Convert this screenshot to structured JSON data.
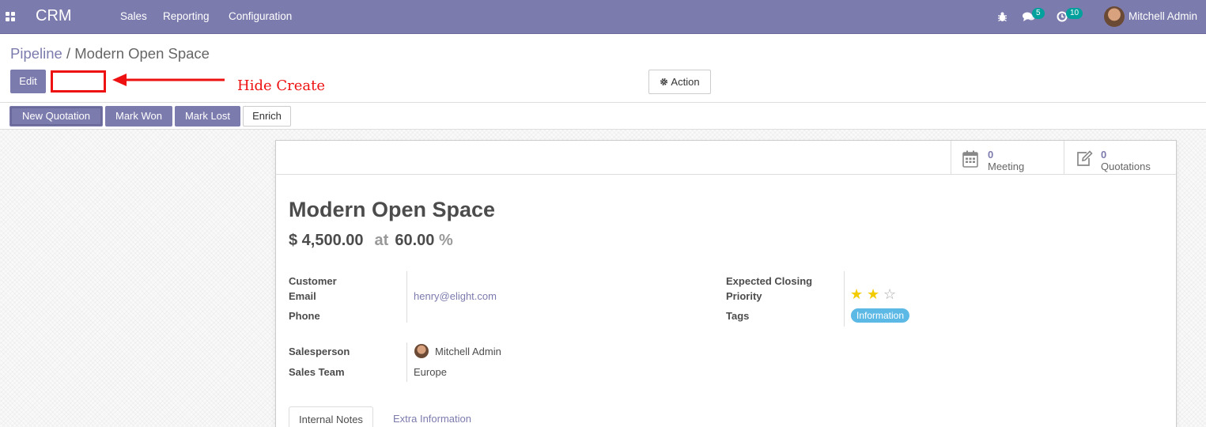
{
  "navbar": {
    "app_name": "CRM",
    "menus": [
      "Sales",
      "Reporting",
      "Configuration"
    ],
    "messages_count": "5",
    "activities_count": "10",
    "user_name": "Mitchell Admin"
  },
  "breadcrumb": {
    "parent": "Pipeline",
    "separator": " / ",
    "current": "Modern Open Space"
  },
  "control": {
    "edit_label": "Edit",
    "action_label": "Action",
    "annotation_text": "Hide Create"
  },
  "statusbar": {
    "buttons": [
      "New Quotation",
      "Mark Won",
      "Mark Lost",
      "Enrich"
    ]
  },
  "smart_buttons": [
    {
      "value": "0",
      "label": "Meeting",
      "icon": "calendar-icon"
    },
    {
      "value": "0",
      "label": "Quotations",
      "icon": "edit-icon"
    }
  ],
  "record": {
    "title": "Modern Open Space",
    "revenue": "$ 4,500.00",
    "at": "at",
    "probability": "60.00",
    "percent": "%"
  },
  "fields_left": {
    "customer_label": "Customer",
    "email_label": "Email",
    "email_value": "henry@elight.com",
    "phone_label": "Phone",
    "salesperson_label": "Salesperson",
    "salesperson_value": "Mitchell Admin",
    "sales_team_label": "Sales Team",
    "sales_team_value": "Europe"
  },
  "fields_right": {
    "expected_closing_label": "Expected Closing",
    "priority_label": "Priority",
    "priority_stars": 2,
    "priority_max": 3,
    "tags_label": "Tags",
    "tag_value": "Information"
  },
  "notebook": {
    "tabs": [
      "Internal Notes",
      "Extra Information"
    ]
  },
  "colors": {
    "brand": "#7c7bad",
    "badge": "#00a09d",
    "annotation": "#ee1111",
    "star": "#f3cc00",
    "tag": "#5cb8e4"
  }
}
